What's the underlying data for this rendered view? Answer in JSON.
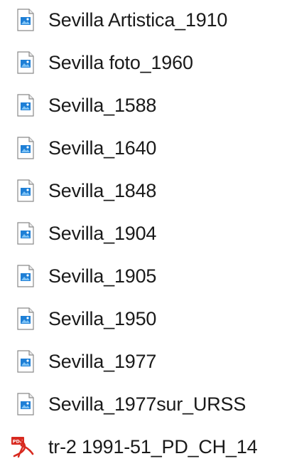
{
  "files": [
    {
      "name": "Sevilla Artistica_1910",
      "icon": "image-file-icon"
    },
    {
      "name": "Sevilla foto_1960",
      "icon": "image-file-icon"
    },
    {
      "name": "Sevilla_1588",
      "icon": "image-file-icon"
    },
    {
      "name": "Sevilla_1640",
      "icon": "image-file-icon"
    },
    {
      "name": "Sevilla_1848",
      "icon": "image-file-icon"
    },
    {
      "name": "Sevilla_1904",
      "icon": "image-file-icon"
    },
    {
      "name": "Sevilla_1905",
      "icon": "image-file-icon"
    },
    {
      "name": "Sevilla_1950",
      "icon": "image-file-icon"
    },
    {
      "name": "Sevilla_1977",
      "icon": "image-file-icon"
    },
    {
      "name": "Sevilla_1977sur_URSS",
      "icon": "image-file-icon"
    },
    {
      "name": "tr-2 1991-51_PD_CH_14",
      "icon": "pdf-file-icon"
    }
  ],
  "colors": {
    "text": "#1a1a1a",
    "image_icon_blue": "#1e7fd6",
    "pdf_icon_red": "#d82a20"
  }
}
